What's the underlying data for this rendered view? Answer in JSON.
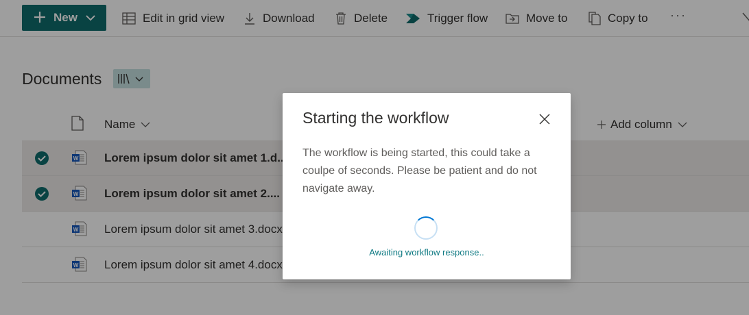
{
  "toolbar": {
    "new_label": "New",
    "edit_grid_label": "Edit in grid view",
    "download_label": "Download",
    "delete_label": "Delete",
    "trigger_flow_label": "Trigger flow",
    "move_to_label": "Move to",
    "copy_to_label": "Copy to",
    "more_label": "···"
  },
  "library": {
    "title": "Documents"
  },
  "list": {
    "columns": {
      "name": "Name",
      "add_column": "Add column"
    },
    "rows": [
      {
        "name": "Lorem ipsum dolor sit amet 1.d...",
        "selected": true
      },
      {
        "name": "Lorem ipsum dolor sit amet 2....",
        "selected": true
      },
      {
        "name": "Lorem ipsum dolor sit amet 3.docx",
        "selected": false
      },
      {
        "name": "Lorem ipsum dolor sit amet 4.docx",
        "selected": false
      }
    ]
  },
  "dialog": {
    "title": "Starting the workflow",
    "body": "The workflow is being started, this could take a coulpe of seconds. Please be patient and do not navigate away.",
    "status": "Awaiting workflow response.."
  },
  "colors": {
    "accent": "#106d6c",
    "status_text": "#0f7a83",
    "word_blue": "#185abd"
  }
}
